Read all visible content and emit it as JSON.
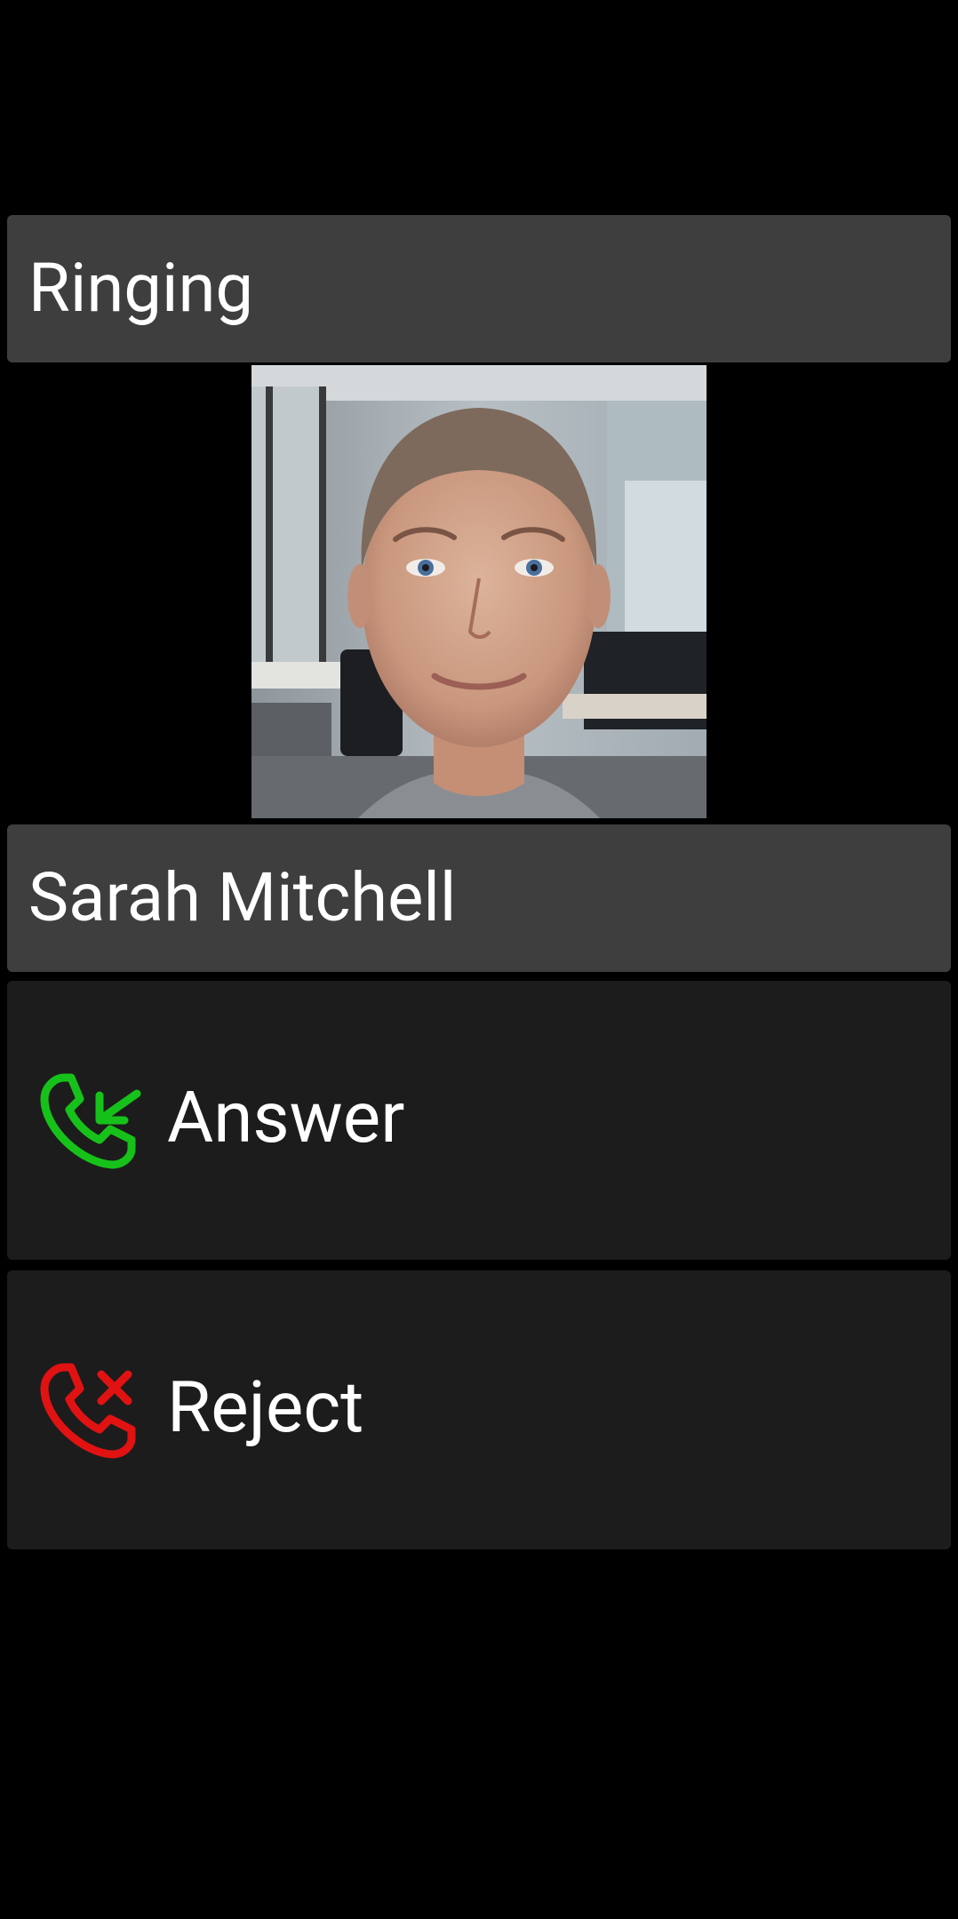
{
  "call": {
    "status": "Ringing",
    "caller_name": "Sarah Mitchell"
  },
  "actions": {
    "answer_label": "Answer",
    "reject_label": "Reject"
  },
  "icons": {
    "answer": "phone-incoming-icon",
    "reject": "phone-reject-icon"
  },
  "colors": {
    "background": "#000000",
    "header_bar": "#3e3e3e",
    "action_bar": "#1c1c1c",
    "answer_accent": "#16c21a",
    "reject_accent": "#e11212",
    "text": "#ffffff"
  }
}
